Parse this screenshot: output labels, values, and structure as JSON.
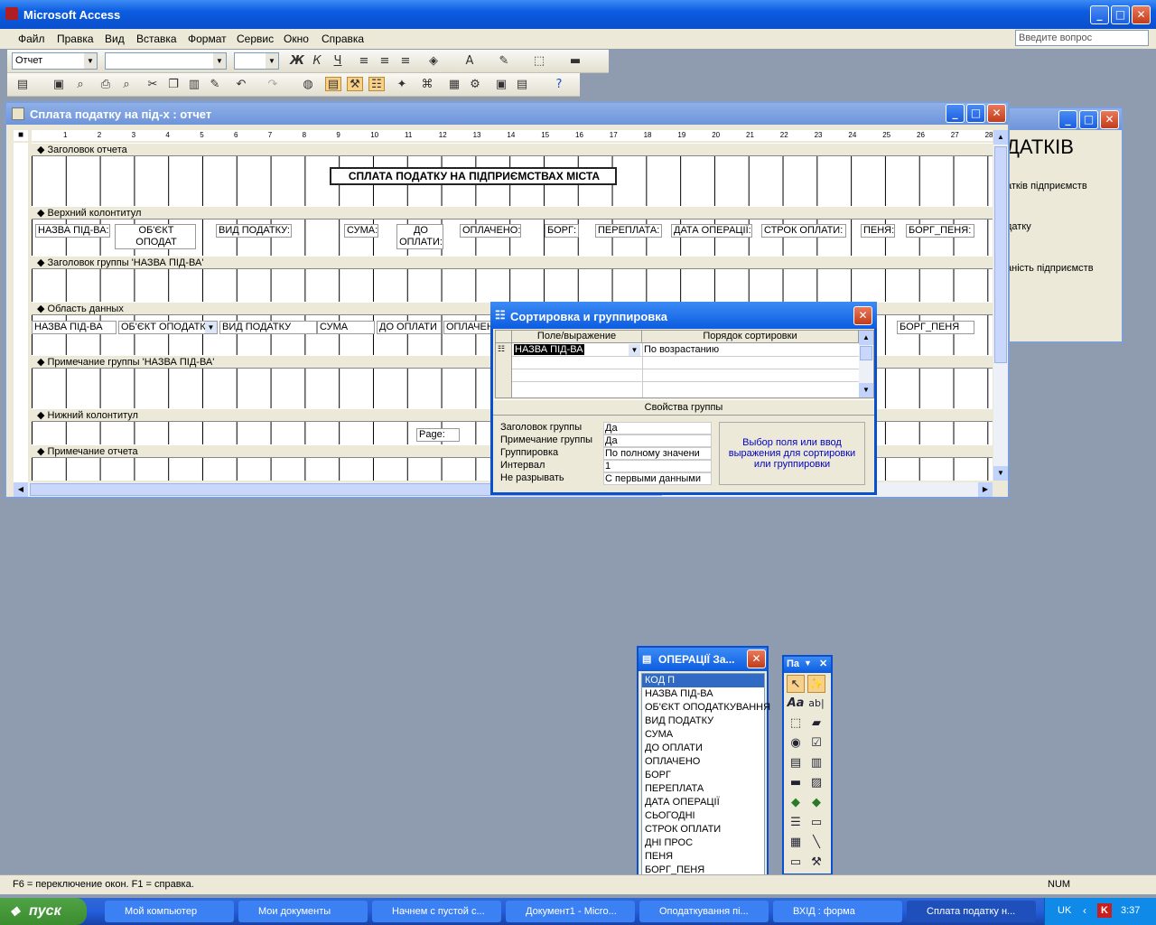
{
  "app": {
    "title": "Microsoft Access"
  },
  "menu": [
    "Файл",
    "Правка",
    "Вид",
    "Вставка",
    "Формат",
    "Сервис",
    "Окно",
    "Справка"
  ],
  "help_placeholder": "Введите вопрос",
  "format_bar": {
    "object_combo": "Отчет"
  },
  "report": {
    "title": "Сплата податку на під-х : отчет",
    "ruler_numbers": [
      "1",
      "2",
      "3",
      "4",
      "5",
      "6",
      "7",
      "8",
      "9",
      "10",
      "11",
      "12",
      "13",
      "14",
      "15",
      "16",
      "17",
      "18",
      "19",
      "20",
      "21",
      "22",
      "23",
      "24",
      "25",
      "26",
      "27",
      "28"
    ],
    "sections": [
      "Заголовок отчета",
      "Верхний колонтитул",
      "Заголовок группы 'НАЗВА ПІД-ВА'",
      "Область данных",
      "Примечание группы 'НАЗВА ПІД-ВА'",
      "Нижний колонтитул",
      "Примечание отчета"
    ],
    "report_title": "СПЛАТА ПОДАТКУ НА ПІДПРИЄМСТВАХ МІСТА",
    "header_labels": [
      "НАЗВА ПІД-ВА:",
      "ОБ'ЄКТ ОПОДАТ КУВАННЯ:",
      "ВИД ПОДАТКУ:",
      "СУМА:",
      "ДО ОПЛАТИ:",
      "ОПЛАЧЕНО:",
      "БОРГ:",
      "ПЕРЕПЛАТА:",
      "ДАТА ОПЕРАЦІЇ:",
      "СТРОК ОПЛАТИ:",
      "ПЕНЯ:",
      "БОРГ_ПЕНЯ:"
    ],
    "detail_fields": [
      "НАЗВА ПІД-ВА",
      "ОБ'ЄКТ ОПОДАТК",
      "ВИД ПОДАТКУ",
      "СУМА",
      "ДО ОПЛАТИ",
      "ОПЛАЧЕН",
      "БОРГ_ПЕНЯ"
    ],
    "page_field": "Page:"
  },
  "bg_window": {
    "big": "ДАТКІВ",
    "l1": "атків підприємств",
    "l2": "датку",
    "l3": "аність підприємств"
  },
  "sort": {
    "title": "Сортировка и группировка",
    "col_field": "Поле/выражение",
    "col_order": "Порядок сортировки",
    "row_field": "НАЗВА ПІД-ВА",
    "row_order": "По возрастанию",
    "props_title": "Свойства группы",
    "props": [
      {
        "label": "Заголовок группы",
        "value": "Да"
      },
      {
        "label": "Примечание группы",
        "value": "Да"
      },
      {
        "label": "Группировка",
        "value": "По полному значени"
      },
      {
        "label": "Интервал",
        "value": "1"
      },
      {
        "label": "Не разрывать",
        "value": "С первыми данными"
      }
    ],
    "hint": "Выбор поля или ввод выражения для сортировки или группировки"
  },
  "field_list": {
    "title": "ОПЕРАЦІЇ За...",
    "items": [
      "КОД П",
      "НАЗВА ПІД-ВА",
      "ОБ'ЄКТ ОПОДАТКУВАННЯ",
      "ВИД ПОДАТКУ",
      "СУМА",
      "ДО ОПЛАТИ",
      "ОПЛАЧЕНО",
      "БОРГ",
      "ПЕРЕПЛАТА",
      "ДАТА ОПЕРАЦІЇ",
      "СЬОГОДНІ",
      "СТРОК ОПЛАТИ",
      "ДНІ ПРОС",
      "ПЕНЯ",
      "БОРГ_ПЕНЯ"
    ]
  },
  "toolbox": {
    "title": "Па"
  },
  "status": {
    "text": "F6 = переключение окон.  F1 = справка.",
    "num": "NUM"
  },
  "taskbar": {
    "start": "пуск",
    "tasks": [
      "Мой компьютер",
      "Мои документы",
      "Начнем с пустой с...",
      "Документ1 - Micro...",
      "Оподаткування пі...",
      "ВХІД : форма",
      "Сплата податку н..."
    ],
    "lang": "UK",
    "clock": "3:37"
  }
}
